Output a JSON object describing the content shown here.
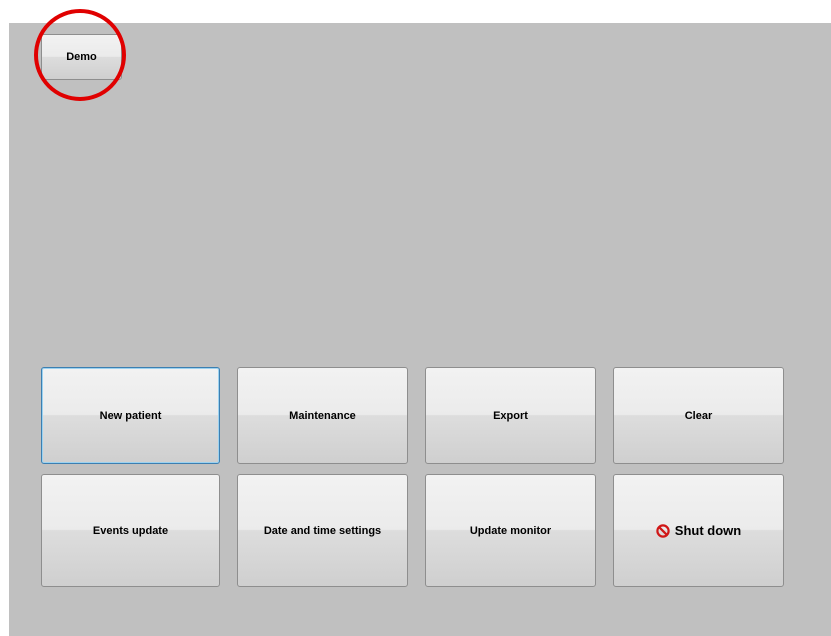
{
  "demo": {
    "label": "Demo"
  },
  "buttons": {
    "new_patient": "New patient",
    "maintenance": "Maintenance",
    "export": "Export",
    "clear": "Clear",
    "events_update": "Events update",
    "date_time_settings": "Date and time settings",
    "update_monitor": "Update monitor",
    "shut_down": "Shut down"
  },
  "icons": {
    "shut_down": "prohibited-icon"
  },
  "colors": {
    "panel_background": "#c0c0c0",
    "highlight_circle": "#e00000",
    "focus_border": "#3c7fb1",
    "shutdown_icon": "#d01818"
  },
  "state": {
    "focused_button": "new_patient",
    "highlighted_button": "demo"
  }
}
